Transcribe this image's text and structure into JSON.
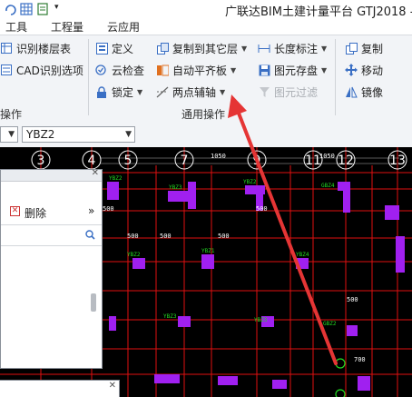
{
  "window": {
    "title": "广联达BIM土建计量平台 GTJ2018 - [F"
  },
  "menu": {
    "items": [
      "工具",
      "工程量",
      "云应用"
    ]
  },
  "ribbon": {
    "left_group": {
      "items": [
        "识别楼层表",
        "CAD识别选项"
      ],
      "label": "操作"
    },
    "common_ops": {
      "label": "通用操作",
      "define": "定义",
      "cloud_check": "云检查",
      "lock": "锁定",
      "copy_to_floors": "复制到其它层",
      "auto_slab": "自动平齐板",
      "two_point_axis": "两点辅轴",
      "length_dim": "长度标注",
      "elem_save": "图元存盘",
      "elem_filter": "图元过滤"
    },
    "edit_group": {
      "copy": "复制",
      "move": "移动",
      "mirror": "镜像"
    }
  },
  "selector": {
    "type_value": "YBZ2"
  },
  "panel": {
    "delete_label": "删除",
    "more": "»"
  },
  "canvas": {
    "axis_labels": [
      {
        "text": "3"
      },
      {
        "text": "4"
      },
      {
        "text": "5"
      },
      {
        "text": "7"
      },
      {
        "text": "9"
      },
      {
        "text": "11"
      },
      {
        "text": "12"
      },
      {
        "text": "13"
      }
    ],
    "column_labels": [
      "YBZ2",
      "YBZ3",
      "YBZ4",
      "YBZ1",
      "GBZ4",
      "GBZ2"
    ],
    "dim_labels": [
      "500",
      "1050",
      "700"
    ]
  },
  "colors": {
    "grid_red": "#e01010",
    "column_fill": "#a020f0",
    "annotation_green": "#22dd22",
    "arrow_red": "#e53535"
  }
}
